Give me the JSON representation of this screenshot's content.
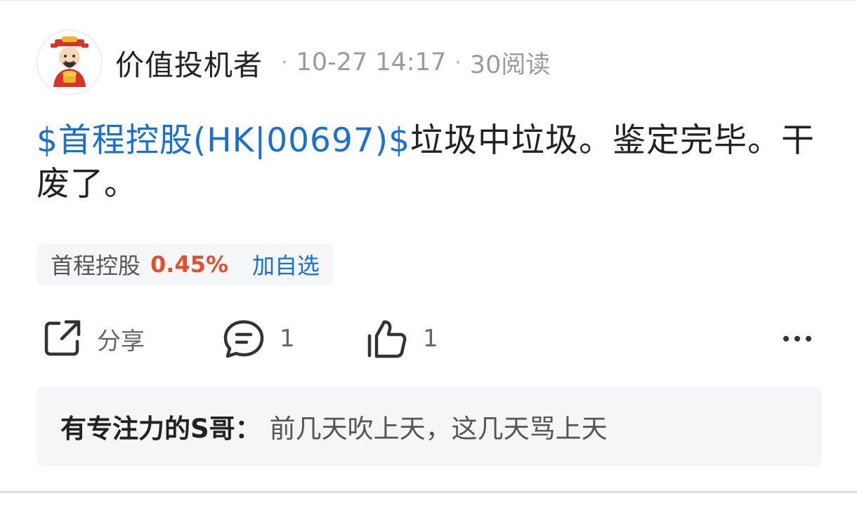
{
  "post": {
    "author": "价值投机者",
    "time": "10-27 14:17",
    "reads": "30阅读",
    "stock_tag": "$首程控股(HK|00697)$",
    "body_text": "垃圾中垃圾。鉴定完毕。干废了。"
  },
  "stock_chip": {
    "name": "首程控股",
    "change": "0.45%",
    "add_label": "加自选"
  },
  "actions": {
    "share_label": "分享",
    "comment_count": "1",
    "like_count": "1"
  },
  "comment_preview": {
    "user": "有专注力的S哥",
    "separator": "：",
    "text": "前几天吹上天，这几天骂上天"
  },
  "icons": {
    "avatar": "cartoon-avatar",
    "share": "share-icon",
    "comment": "comment-icon",
    "like": "thumbs-up-icon",
    "more": "more-dots-icon"
  },
  "colors": {
    "link": "#1a6fd0",
    "up": "#e4502d",
    "text": "#222222",
    "muted": "#9b9b9b"
  }
}
